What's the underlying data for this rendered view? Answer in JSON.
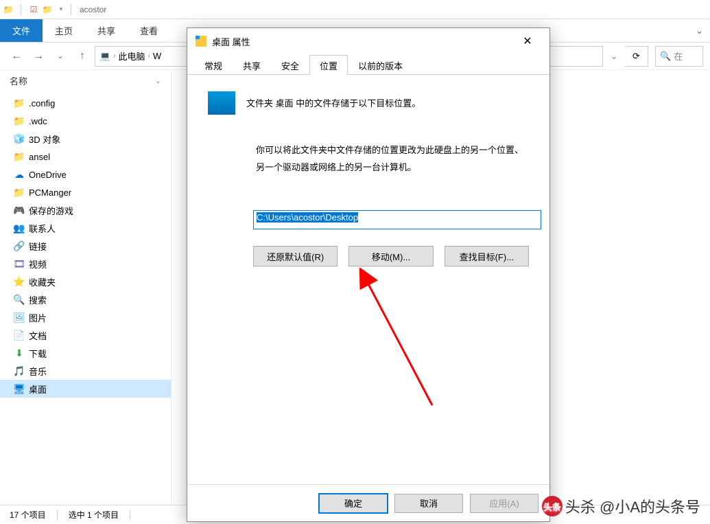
{
  "titlebar": {
    "title": "acostor"
  },
  "ribbon": {
    "file": "文件",
    "tabs": [
      "主页",
      "共享",
      "查看"
    ]
  },
  "addressbar": {
    "crumbs": [
      "此电脑",
      "W"
    ]
  },
  "search": {
    "placeholder": "在"
  },
  "sidebar": {
    "header": "名称",
    "items": [
      {
        "label": ".config",
        "icon": "folder-y"
      },
      {
        "label": ".wdc",
        "icon": "folder-y"
      },
      {
        "label": "3D 对象",
        "icon": "box3d"
      },
      {
        "label": "ansel",
        "icon": "folder-y"
      },
      {
        "label": "OneDrive",
        "icon": "cloud"
      },
      {
        "label": "PCManger",
        "icon": "folder-y"
      },
      {
        "label": "保存的游戏",
        "icon": "game"
      },
      {
        "label": "联系人",
        "icon": "ppl"
      },
      {
        "label": "链接",
        "icon": "link"
      },
      {
        "label": "视频",
        "icon": "vid"
      },
      {
        "label": "收藏夹",
        "icon": "star"
      },
      {
        "label": "搜索",
        "icon": "srch"
      },
      {
        "label": "图片",
        "icon": "pic"
      },
      {
        "label": "文档",
        "icon": "doc"
      },
      {
        "label": "下载",
        "icon": "dl"
      },
      {
        "label": "音乐",
        "icon": "music"
      },
      {
        "label": "桌面",
        "icon": "desk",
        "selected": true
      }
    ]
  },
  "statusbar": {
    "count": "17 个项目",
    "selected": "选中 1 个项目"
  },
  "dialog": {
    "title": "桌面 属性",
    "tabs": [
      "常规",
      "共享",
      "安全",
      "位置",
      "以前的版本"
    ],
    "active_tab": 3,
    "info_text": "文件夹 桌面 中的文件存储于以下目标位置。",
    "desc_text": "你可以将此文件夹中文件存储的位置更改为此硬盘上的另一个位置、另一个驱动器或网络上的另一台计算机。",
    "path": "C:\\Users\\acostor\\Desktop",
    "buttons": {
      "restore": "还原默认值(R)",
      "move": "移动(M)...",
      "find": "查找目标(F)..."
    },
    "footer": {
      "ok": "确定",
      "cancel": "取消",
      "apply": "应用(A)"
    }
  },
  "watermark": "头杀 @小A的头条号"
}
